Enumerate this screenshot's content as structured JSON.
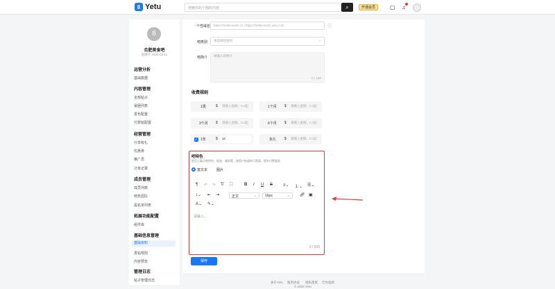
{
  "header": {
    "logo_mark": "8",
    "logo_text": "Yetu",
    "search_placeholder": "搜索你的个圈的内容",
    "vip_label": "开通会员"
  },
  "group": {
    "avatar_glyph": "8",
    "name": "合肥美食吧",
    "created": "创建于 2025-02-11"
  },
  "sidebar": {
    "sections": [
      {
        "title": "运营分析",
        "items": [
          "基础数据"
        ]
      },
      {
        "title": "内容管理",
        "items": [
          "全部帖子",
          "幂圈列表",
          "发布配置",
          "付费帖配置"
        ]
      },
      {
        "title": "经营管理",
        "items": [
          "分享有礼",
          "优惠券",
          "推广员",
          "订单记录"
        ]
      },
      {
        "title": "成员管理",
        "items": [
          "成员列表",
          "吧务团队",
          "黑名单列表"
        ]
      },
      {
        "title": "拓展功能配置",
        "items": [
          "组件库"
        ]
      },
      {
        "title": "基础信息管理",
        "items": [
          "基础资料",
          "发帖规则",
          "内容预览"
        ]
      },
      {
        "title": "管理日志",
        "items": [
          "帖子管理日志"
        ]
      }
    ],
    "active": "基础资料"
  },
  "form": {
    "domain_label": "个性域名",
    "domain_value": "https://hefeimeishi.cn  |  https://hefeimeishi.yetu.com",
    "category_label": "吧类别",
    "category_placeholder": "请选择吧类别",
    "intro_label": "吧简介",
    "intro_placeholder": "请输入吧简介",
    "intro_count": "0 / 100",
    "fee_title": "收费规则",
    "currency": "$",
    "fee_placeholder": "请输入金额，0.1起",
    "fees": [
      {
        "period": "1周",
        "value": ""
      },
      {
        "period": "1个月",
        "value": ""
      },
      {
        "period": "3个月",
        "value": ""
      },
      {
        "period": "6个月",
        "value": ""
      },
      {
        "period": "1年",
        "value": "10",
        "checked": true
      },
      {
        "period": "永久",
        "value": ""
      }
    ],
    "feature_title": "吧特色",
    "feature_desc": "首页上展示吧特色、权益、福利等，使用户快速的可直观，提升付费意愿",
    "radio_rich": "富文本",
    "radio_image": "图片",
    "font_name": "正文",
    "font_size": "16px",
    "editor_placeholder": "请输入...",
    "editor_count": "0 / 500",
    "save_label": "保存"
  },
  "footer": {
    "links": [
      "关于Yetu",
      "服务协议",
      "隐私政策",
      "行为准则"
    ],
    "copyright": "© 2025 Yetu"
  },
  "colors": {
    "accent": "#1677ff",
    "highlight": "#e03c3c"
  }
}
